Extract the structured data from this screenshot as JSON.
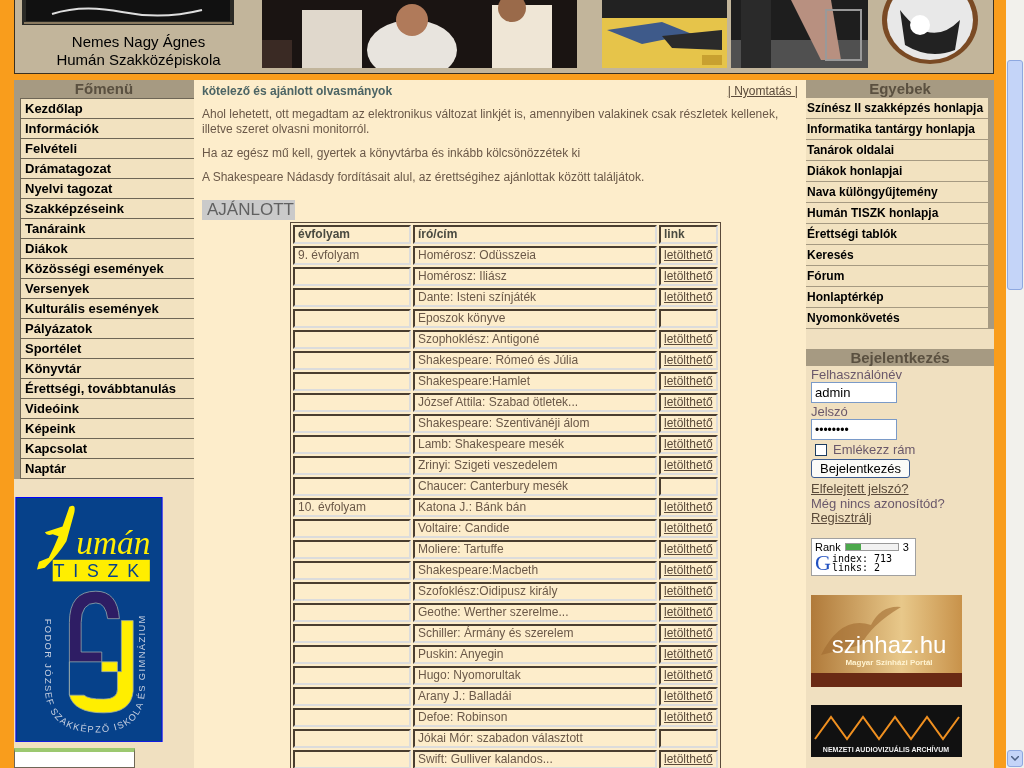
{
  "header": {
    "school_name": [
      "Nemes Nagy Ágnes",
      "Humán Szakközépiskola"
    ]
  },
  "main_menu": {
    "title": "Főmenü",
    "items": [
      "Kezdőlap",
      "Információk",
      "Felvételi",
      "Drámatagozat",
      "Nyelvi tagozat",
      "Szakképzéseink",
      "Tanáraink",
      "Diákok",
      "Közösségi események",
      "Versenyek",
      "Kulturális események",
      "Pályázatok",
      "Sportélet",
      "Könyvtár",
      "Érettségi, továbbtanulás",
      "Videóink",
      "Képeink",
      "Kapcsolat",
      "Naptár"
    ]
  },
  "logos": {
    "tiszk_word": "umán",
    "tiszk_badge": "TISZK",
    "school_ring": "FODOR JÓZSEF SZAKKÉPZŐ ISKOLA ÉS GIMNÁZIUM"
  },
  "content": {
    "title": "kötelező és ajánlott olvasmányok",
    "print_link": "| Nyomtatás |",
    "paragraphs": [
      "Ahol lehetett, ott megadtam az elektronikus változat linkjét is, amennyiben valakinek csak részletek kellenek, illetve szeret olvasni monitorról.",
      "Ha az egész mű kell, gyertek a könyvtárba és inkább kölcsönözzétek ki",
      "A Shakespeare Nádasdy fordításait alul, az érettségihez ajánlottak között találjátok."
    ],
    "section_title": "AJÁNLOTT",
    "table": {
      "columns": [
        "évfolyam",
        "író/cím",
        "link"
      ],
      "rows": [
        {
          "year": "9. évfolyam",
          "title": "Homérosz: Odüsszeia",
          "link": "letölthető"
        },
        {
          "title": "Homérosz: Iliász",
          "link": "letölthető"
        },
        {
          "title": "Dante: Isteni színjáték",
          "link": "letölthető"
        },
        {
          "title": "Eposzok könyve"
        },
        {
          "title": "Szophoklész: Antigoné",
          "link": "letölthető"
        },
        {
          "title": "Shakespeare: Rómeó és Júlia",
          "link": "letölthető"
        },
        {
          "title": "Shakespeare:Hamlet",
          "link": "letölthető"
        },
        {
          "title": "József Attila: Szabad ötletek...",
          "link": "letölthető"
        },
        {
          "title": "Shakespeare: Szentivánéji álom",
          "link": "letölthető"
        },
        {
          "title": "Lamb: Shakespeare mesék",
          "link": "letölthető"
        },
        {
          "title": "Zrinyi: Szigeti veszedelem",
          "link": "letölthető"
        },
        {
          "title": "Chaucer: Canterbury mesék"
        },
        {
          "year": "10. évfolyam",
          "title": "Katona J.: Bánk bán",
          "link": "letölthető"
        },
        {
          "title": "Voltaire: Candide",
          "link": "letölthető"
        },
        {
          "title": "Moliere: Tartuffe",
          "link": "letölthető"
        },
        {
          "title": "Shakespeare:Macbeth",
          "link": "letölthető"
        },
        {
          "title": "Szofoklész:Oidipusz király",
          "link": "letölthető"
        },
        {
          "title": "Geothe: Werther szerelme...",
          "link": "letölthető"
        },
        {
          "title": "Schiller: Ármány és szerelem",
          "link": "letölthető"
        },
        {
          "title": "Puskin: Anyegin",
          "link": "letölthető"
        },
        {
          "title": "Hugo: Nyomorultak",
          "link": "letölthető"
        },
        {
          "title": "Arany J.: Balladái",
          "link": "letölthető"
        },
        {
          "title": "Defoe: Robinson",
          "link": "letölthető"
        },
        {
          "title": "Jókai Mór: szabadon választott"
        },
        {
          "title": "Swift: Gulliver kalandos...",
          "link": "letölthető"
        }
      ]
    }
  },
  "other_links": {
    "title": "Egyebek",
    "items": [
      "Színész II szakképzés honlapja",
      "Informatika tantárgy honlapja",
      "Tanárok oldalai",
      "Diákok honlapjai",
      "Nava különgyűjtemény",
      "Humán TISZK honlapja",
      "Érettségi tablók",
      "Keresés",
      "Fórum",
      "Honlaptérkép",
      "Nyomonkövetés"
    ]
  },
  "login": {
    "title": "Bejelentkezés",
    "username_label": "Felhasználónév",
    "username_value": "admin",
    "password_label": "Jelszó",
    "password_value": "••••••••",
    "remember_label": "Emlékezz rám",
    "remember_checked": false,
    "submit": "Bejelentkezés",
    "forgot_link": "Elfelejtett jelszó?",
    "no_account_text": "Még nincs azonosítód?",
    "register_link": "Regisztrálj"
  },
  "rank_widget": {
    "label": "Rank",
    "level": 0.3,
    "value": "3",
    "logo_letter": "G",
    "index_line": "index: 713",
    "links_line": "links: 2"
  },
  "banners": {
    "theatre_name": "szinhaz.hu",
    "theatre_tagline": "Magyar Színházi Portál",
    "archive_name": "NEMZETI AUDIOVIZUÁLIS ARCHÍVUM"
  }
}
